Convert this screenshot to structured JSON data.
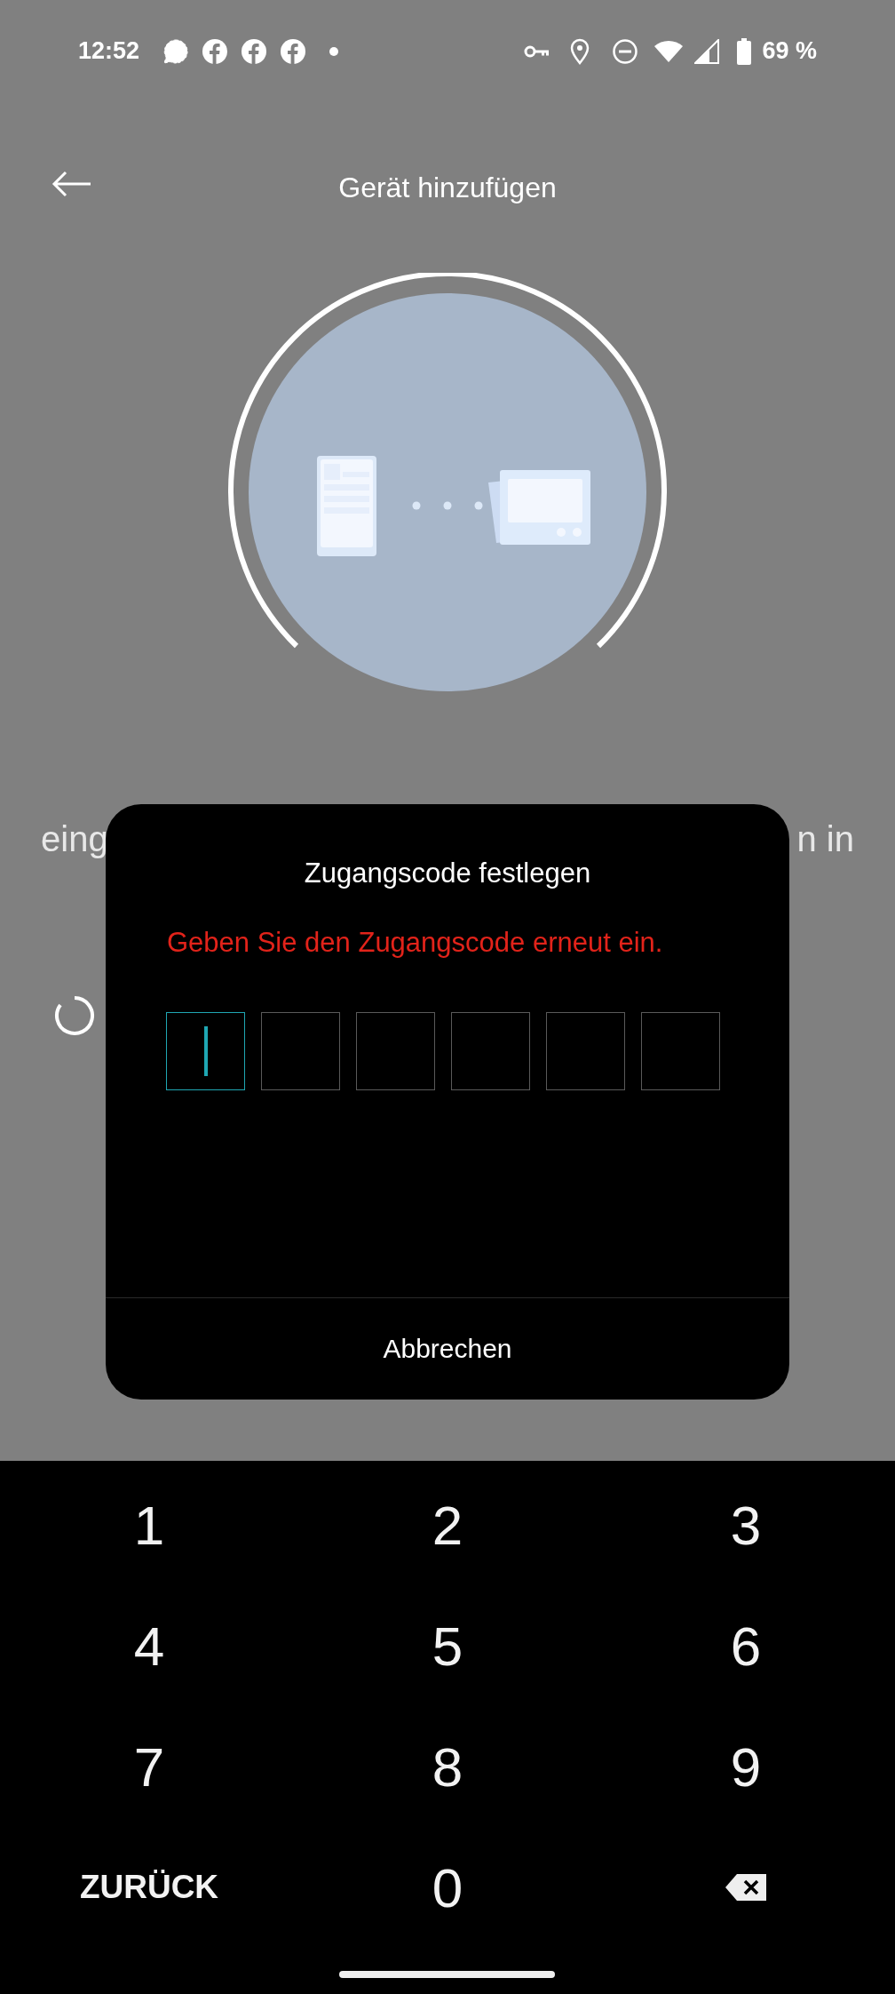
{
  "status_bar": {
    "time": "12:52",
    "battery": "69 %"
  },
  "header": {
    "title": "Gerät hinzufügen"
  },
  "background_text": {
    "fragments": [
      "eing",
      "n in"
    ]
  },
  "dialog": {
    "title": "Zugangscode festlegen",
    "message": "Geben Sie den Zugangscode erneut ein.",
    "cancel": "Abbrechen",
    "code_boxes": [
      {
        "focused": true
      },
      {
        "focused": false
      },
      {
        "focused": false
      },
      {
        "focused": false
      },
      {
        "focused": false
      },
      {
        "focused": false
      }
    ]
  },
  "keypad": {
    "keys": [
      {
        "kind": "digit",
        "label": "1"
      },
      {
        "kind": "digit",
        "label": "2"
      },
      {
        "kind": "digit",
        "label": "3"
      },
      {
        "kind": "digit",
        "label": "4"
      },
      {
        "kind": "digit",
        "label": "5"
      },
      {
        "kind": "digit",
        "label": "6"
      },
      {
        "kind": "digit",
        "label": "7"
      },
      {
        "kind": "digit",
        "label": "8"
      },
      {
        "kind": "digit",
        "label": "9"
      },
      {
        "kind": "text",
        "label": "ZURÜCK"
      },
      {
        "kind": "digit",
        "label": "0"
      },
      {
        "kind": "backspace"
      }
    ]
  }
}
